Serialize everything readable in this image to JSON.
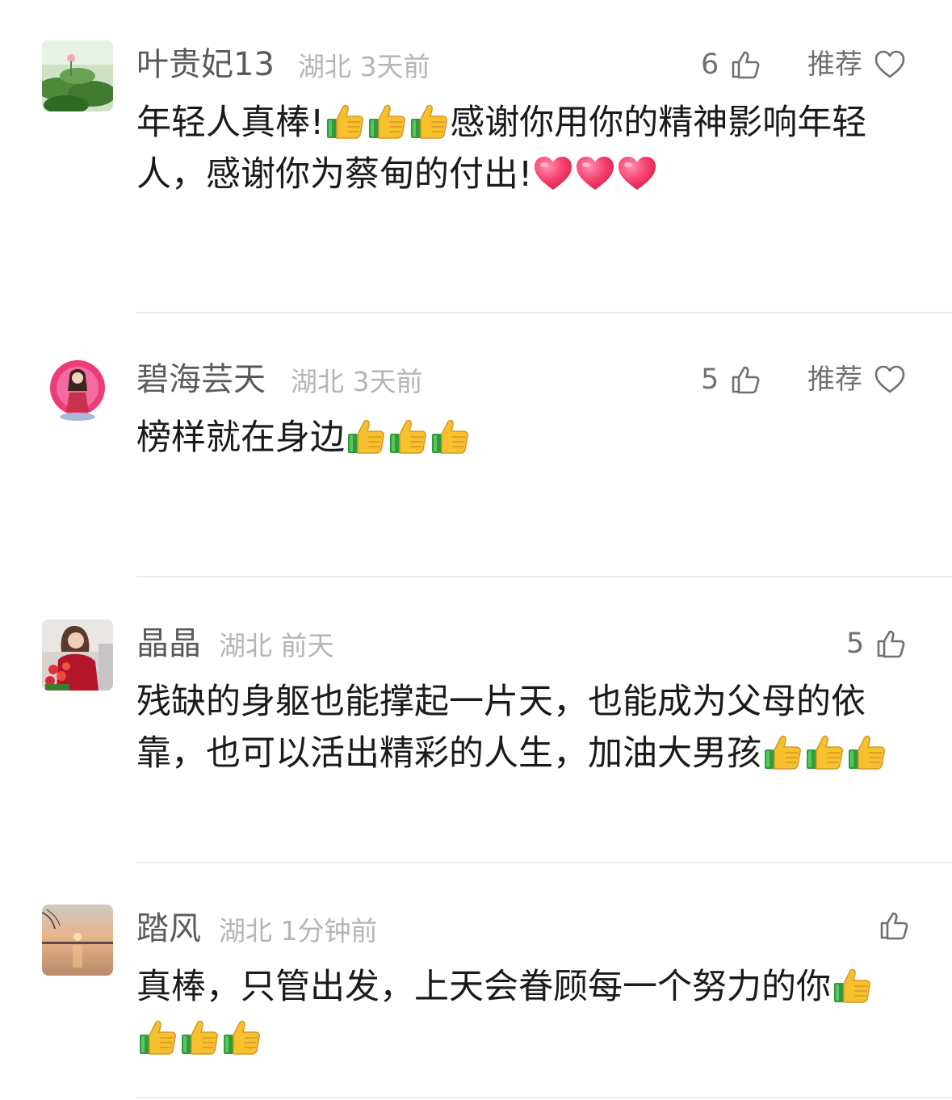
{
  "comments": [
    {
      "user": "叶贵妃13",
      "location": "湖北",
      "time": "3天前",
      "like_count": "6",
      "recommend_label": "推荐",
      "text_parts": [
        "年轻人真棒!",
        "感谢你用你的精神影响年轻人，感谢你为蔡甸的付出!"
      ],
      "emojis": [
        "thumbs-up",
        "thumbs-up",
        "thumbs-up",
        "red-heart",
        "red-heart",
        "red-heart"
      ]
    },
    {
      "user": "碧海芸天",
      "location": "湖北",
      "time": "3天前",
      "like_count": "5",
      "recommend_label": "推荐",
      "text_parts": [
        "榜样就在身边"
      ],
      "emojis": [
        "thumbs-up",
        "thumbs-up",
        "thumbs-up"
      ]
    },
    {
      "user": "晶晶",
      "location": "湖北",
      "time": "前天",
      "like_count": "5",
      "text_parts": [
        "残缺的身躯也能撑起一片天，也能成为父母的依靠，也可以活出精彩的人生，加油大男孩"
      ],
      "emojis": [
        "thumbs-up",
        "thumbs-up",
        "thumbs-up"
      ]
    },
    {
      "user": "踏风",
      "location": "湖北",
      "time": "1分钟前",
      "text_parts": [
        "真棒，只管出发，上天会眷顾每一个努力的你"
      ],
      "emojis": [
        "thumbs-up",
        "thumbs-up",
        "thumbs-up",
        "thumbs-up"
      ]
    }
  ],
  "colors": {
    "username": "#5b5b5b",
    "meta": "#b5b5b5",
    "body_text": "#1a1a1a",
    "divider": "#ececec"
  }
}
